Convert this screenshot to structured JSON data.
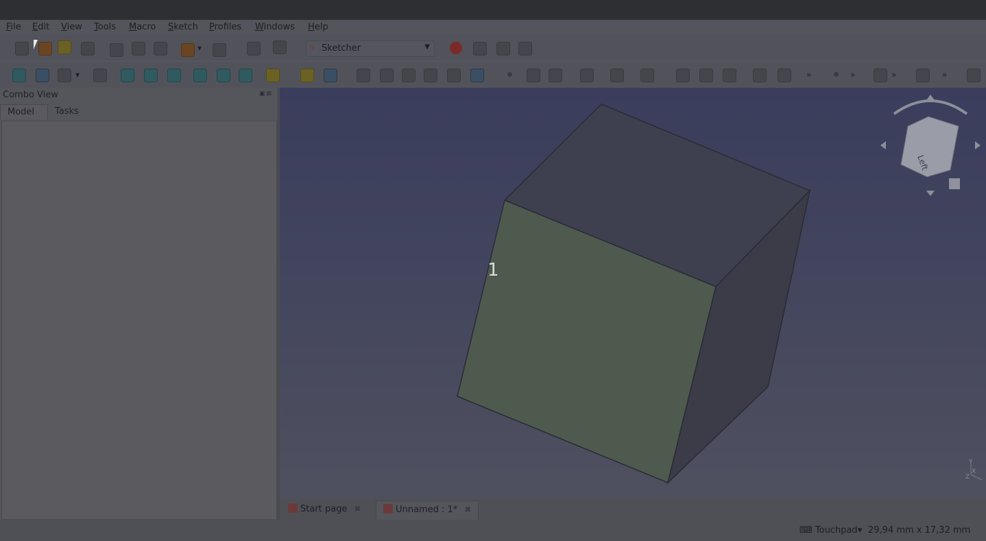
{
  "menu": [
    "File",
    "Edit",
    "View",
    "Tools",
    "Macro",
    "Sketch",
    "Profiles",
    "Windows",
    "Help"
  ],
  "workbench": {
    "selected": "Sketcher",
    "icon": "sketcher-icon"
  },
  "toolbar_overflow": "»",
  "combo_view": {
    "title": "Combo View",
    "tabs": [
      "Model",
      "Tasks"
    ],
    "active_tab": "Model"
  },
  "viewport": {
    "label": "1",
    "navcube_face": "Left",
    "axes": [
      "Y",
      "X",
      "Z"
    ],
    "face_color": "#4e5a4e"
  },
  "documents": [
    {
      "label": "Start page",
      "active": false
    },
    {
      "label": "Unnamed : 1*",
      "active": true
    }
  ],
  "status": {
    "navigation_style": "Touchpad",
    "dimensions": "29,94 mm x 17,32 mm"
  },
  "colors": {
    "background": "#4f5057",
    "viewport_top": "#3a3d5c",
    "cube_front": "#4e5a4e"
  }
}
